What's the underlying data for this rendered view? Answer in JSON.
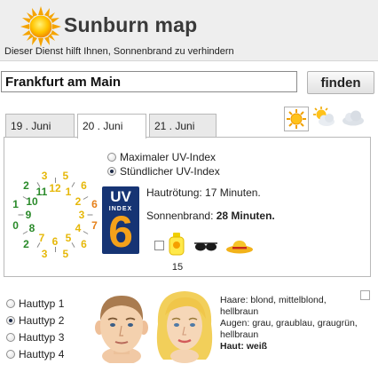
{
  "header": {
    "title": "Sunburn map",
    "subtitle": "Dieser Dienst hilft Ihnen, Sonnenbrand zu verhindern",
    "logo_icon": "sun-icon"
  },
  "search": {
    "value": "Frankfurt am Main",
    "button_label": "finden"
  },
  "tabs": [
    {
      "label": "19 . Juni",
      "active": false
    },
    {
      "label": "20 . Juni",
      "active": true
    },
    {
      "label": "21 . Juni",
      "active": false
    }
  ],
  "weather_icons": [
    "sun-icon",
    "sun-cloud-icon",
    "cloud-icon"
  ],
  "uv_mode": {
    "options": [
      "Maximaler UV-Index",
      "Stündlicher UV-Index"
    ],
    "selected_index": 1
  },
  "clock": {
    "hours": [
      {
        "n": "12",
        "color": "#e6b80a"
      },
      {
        "n": "1",
        "color": "#e6b80a"
      },
      {
        "n": "2",
        "color": "#e6b80a"
      },
      {
        "n": "3",
        "color": "#e6b80a"
      },
      {
        "n": "4",
        "color": "#e6b80a"
      },
      {
        "n": "5",
        "color": "#e6b80a"
      },
      {
        "n": "6",
        "color": "#e6b80a"
      },
      {
        "n": "7",
        "color": "#e6b80a"
      },
      {
        "n": "8",
        "color": "#2a8a2a"
      },
      {
        "n": "9",
        "color": "#2a8a2a"
      },
      {
        "n": "10",
        "color": "#2a8a2a"
      },
      {
        "n": "11",
        "color": "#2a8a2a"
      }
    ],
    "ring": [
      {
        "v": "5",
        "color": "#e6b80a"
      },
      {
        "v": "6",
        "color": "#e6b80a"
      },
      {
        "v": "6",
        "color": "#e6801a"
      },
      {
        "v": "7",
        "color": "#e6801a"
      },
      {
        "v": "6",
        "color": "#e6b80a"
      },
      {
        "v": "5",
        "color": "#e6b80a"
      },
      {
        "v": "3",
        "color": "#e6b80a"
      },
      {
        "v": "2",
        "color": "#2a8a2a"
      },
      {
        "v": "0",
        "color": "#2a8a2a"
      },
      {
        "v": "1",
        "color": "#2a8a2a"
      },
      {
        "v": "2",
        "color": "#2a8a2a"
      },
      {
        "v": "3",
        "color": "#e6b80a"
      }
    ]
  },
  "uv_index": {
    "badge_top": "UV",
    "badge_middle": "INDEX",
    "value": "6",
    "badge_color": "#163474",
    "accent_color": "#f4a11a"
  },
  "info": {
    "redness": "Hautrötung: 17 Minuten.",
    "sunburn_label": "Sonnenbrand:",
    "sunburn_value": "28 Minuten."
  },
  "protection": {
    "spf_value": "15",
    "checked": false
  },
  "skin_types": {
    "options": [
      "Hauttyp 1",
      "Hauttyp 2",
      "Hauttyp 3",
      "Hauttyp 4"
    ],
    "selected_index": 1
  },
  "skin_description": {
    "hair": "Haare: blond, mittelblond, hellbraun",
    "eyes": "Augen: grau, graublau, graugrün, hellbraun",
    "skin": "Haut: weiß"
  }
}
